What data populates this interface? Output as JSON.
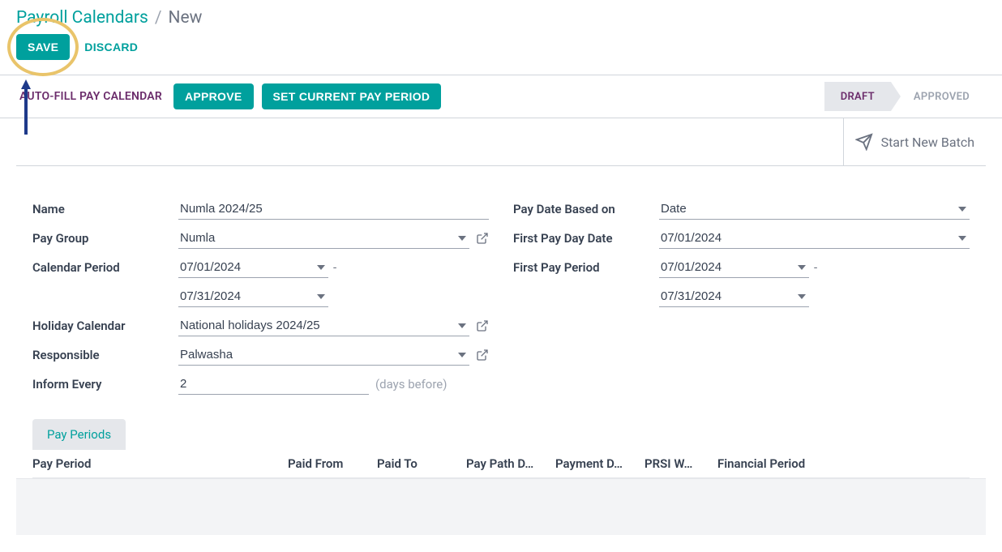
{
  "breadcrumb": {
    "root": "Payroll Calendars",
    "sep": "/",
    "current": "New"
  },
  "actions": {
    "save": "SAVE",
    "discard": "DISCARD"
  },
  "toolbar": {
    "autofill": "AUTO-FILL PAY CALENDAR",
    "approve": "APPROVE",
    "set_current": "SET CURRENT PAY PERIOD"
  },
  "status": {
    "draft": "DRAFT",
    "approved": "APPROVED"
  },
  "batch": {
    "label": "Start New Batch"
  },
  "form": {
    "left": {
      "name_label": "Name",
      "name_value": "Numla 2024/25",
      "pay_group_label": "Pay Group",
      "pay_group_value": "Numla",
      "calendar_period_label": "Calendar Period",
      "calendar_period_from": "07/01/2024",
      "calendar_period_to": "07/31/2024",
      "date_sep": "-",
      "holiday_label": "Holiday Calendar",
      "holiday_value": "National holidays 2024/25",
      "responsible_label": "Responsible",
      "responsible_value": "Palwasha",
      "inform_label": "Inform Every",
      "inform_value": "2",
      "inform_suffix": "(days before)"
    },
    "right": {
      "pay_date_based_label": "Pay Date Based on",
      "pay_date_based_value": "Date",
      "first_pay_day_label": "First Pay Day Date",
      "first_pay_day_value": "07/01/2024",
      "first_pay_period_label": "First Pay Period",
      "first_pay_period_from": "07/01/2024",
      "first_pay_period_to": "07/31/2024",
      "date_sep": "-"
    }
  },
  "tabs": {
    "pay_periods": "Pay Periods"
  },
  "table": {
    "headers": {
      "pay_period": "Pay Period",
      "paid_from": "Paid From",
      "paid_to": "Paid To",
      "pay_path": "Pay Path D…",
      "payment": "Payment D…",
      "prsi": "PRSI W…",
      "financial": "Financial Period"
    }
  }
}
